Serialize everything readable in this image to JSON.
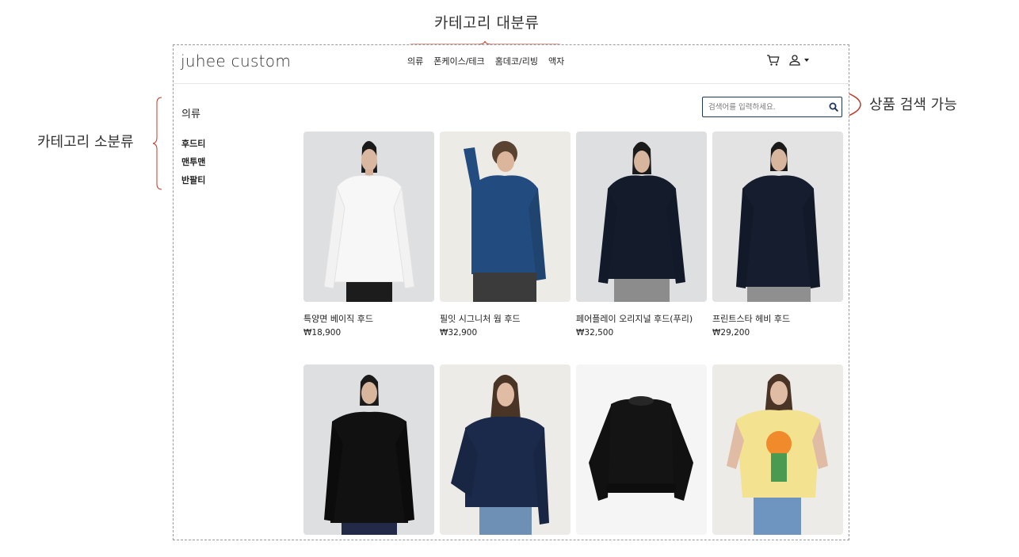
{
  "annotations": {
    "top": "카테고리 대분류",
    "left": "카테고리 소분류",
    "right": "상품 검색 가능"
  },
  "header": {
    "logo": "juhee custom",
    "nav": [
      "의류",
      "폰케이스/테크",
      "홈데코/리빙",
      "액자"
    ]
  },
  "sidebar": {
    "title": "의류",
    "items": [
      "후드티",
      "맨투맨",
      "반팔티"
    ]
  },
  "search": {
    "placeholder": "검색어를 입력하세요."
  },
  "products": [
    {
      "name": "특양면 베이직 후드",
      "price": "₩18,900"
    },
    {
      "name": "필잇 시그니처 웜 후드",
      "price": "₩32,900"
    },
    {
      "name": "페어플레이 오리지널 후드(푸리)",
      "price": "₩32,500"
    },
    {
      "name": "프린트스타 헤비 후드",
      "price": "₩29,200"
    },
    {
      "name": "",
      "price": ""
    },
    {
      "name": "",
      "price": ""
    },
    {
      "name": "",
      "price": ""
    },
    {
      "name": "",
      "price": ""
    }
  ],
  "colors": {
    "annotation_red": "#c0392b",
    "search_border": "#1e3657"
  }
}
